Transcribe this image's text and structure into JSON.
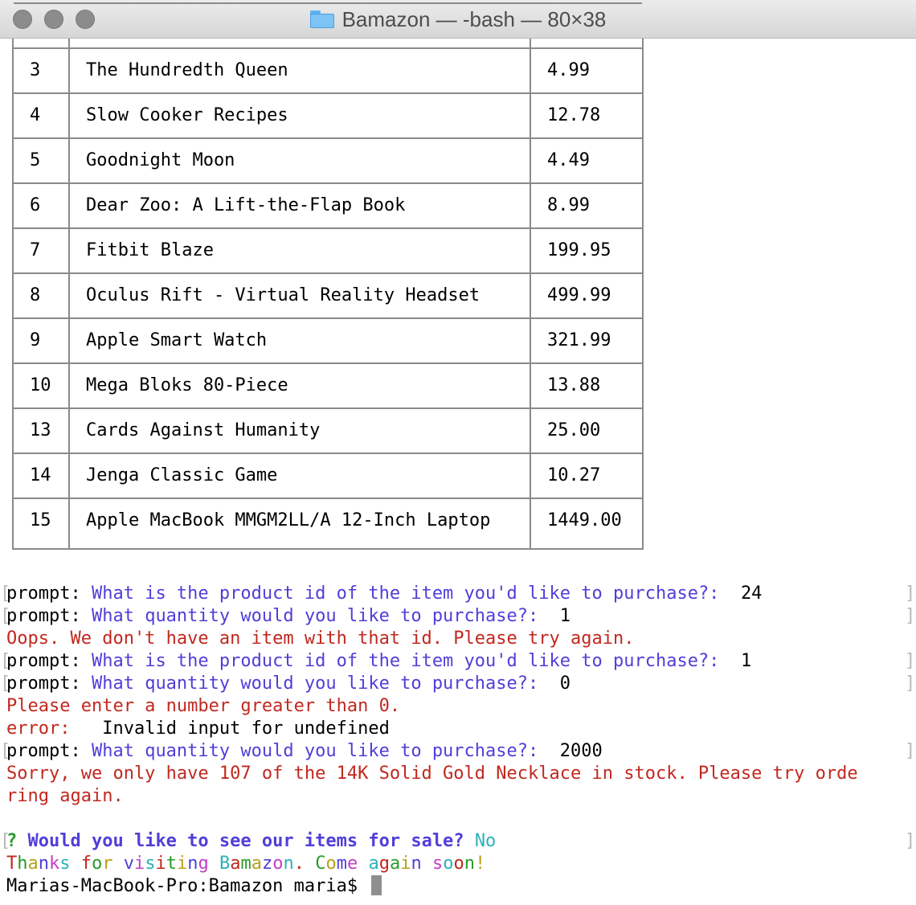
{
  "window": {
    "title": "Bamazon — -bash — 80×38"
  },
  "table": {
    "rows": [
      {
        "id": "3",
        "name": "The Hundredth Queen",
        "price": "4.99"
      },
      {
        "id": "4",
        "name": "Slow Cooker Recipes",
        "price": "12.78"
      },
      {
        "id": "5",
        "name": "Goodnight Moon",
        "price": "4.49"
      },
      {
        "id": "6",
        "name": "Dear Zoo: A Lift-the-Flap Book",
        "price": "8.99"
      },
      {
        "id": "7",
        "name": "Fitbit Blaze",
        "price": "199.95"
      },
      {
        "id": "8",
        "name": "Oculus Rift - Virtual Reality Headset",
        "price": "499.99"
      },
      {
        "id": "9",
        "name": "Apple Smart Watch",
        "price": "321.99"
      },
      {
        "id": "10",
        "name": "Mega Bloks 80-Piece",
        "price": "13.88"
      },
      {
        "id": "13",
        "name": "Cards Against Humanity",
        "price": "25.00"
      },
      {
        "id": "14",
        "name": "Jenga Classic Game",
        "price": "10.27"
      },
      {
        "id": "15",
        "name": "Apple MacBook MMGM2LL/A 12-Inch Laptop",
        "price": "1449.00"
      }
    ]
  },
  "terminal": {
    "prompt_label": "prompt: ",
    "q_product_id": "What is the product id of the item you'd like to purchase?:",
    "q_quantity": "What quantity would you like to purchase?:",
    "answer_1": "24",
    "answer_2": "1",
    "error_no_item": "Oops. We don't have an item with that id. Please try again.",
    "answer_3": "1",
    "answer_4": "0",
    "error_greater_than_zero": "Please enter a number greater than 0.",
    "error_label": "error:",
    "error_invalid": "Invalid input for undefined",
    "answer_5": "2000",
    "stock_error_line1": "Sorry, we only have 107 of the 14K Solid Gold Necklace in stock. Please try orde",
    "stock_error_line2": "ring again.",
    "confirm_marker": "?",
    "confirm_question": "Would you like to see our items for sale?",
    "confirm_answer": "No",
    "thanks": "Thanks for visiting Bamazon. Come again soon!",
    "shell_prompt": "Marias-MacBook-Pro:Bamazon maria$ "
  },
  "colors": {
    "question": "#4f3fd8",
    "error": "#c1281f",
    "answer_cyan": "#2bb3b8",
    "rainbow": [
      "#c1281f",
      "#2a9a2a",
      "#b8a11a",
      "#4f3fd8",
      "#c23fc2",
      "#2bb3b8"
    ]
  }
}
